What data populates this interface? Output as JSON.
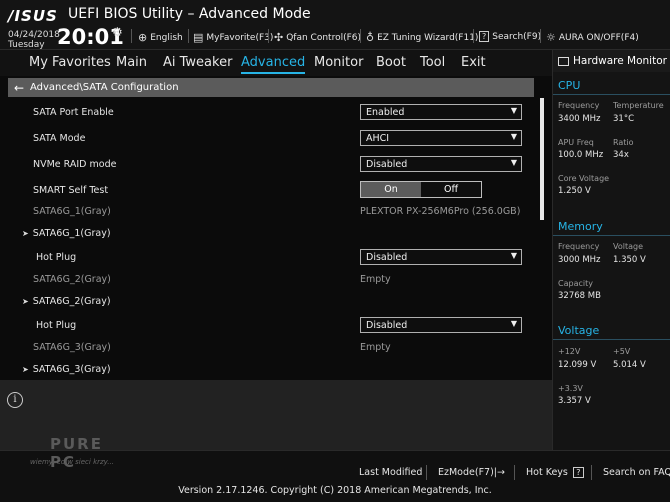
{
  "header": {
    "logo": "/ISUS",
    "title": "UEFI BIOS Utility – Advanced Mode",
    "date": "04/24/2018",
    "day": "Tuesday",
    "time": "20:01",
    "items": [
      {
        "icon": "globe-icon",
        "label": "English"
      },
      {
        "icon": "myfavorite-icon",
        "label": "MyFavorite(F3)"
      },
      {
        "icon": "fan-icon",
        "label": "Qfan Control(F6)"
      },
      {
        "icon": "lightbulb-icon",
        "label": "EZ Tuning Wizard(F11)"
      },
      {
        "icon": "search-icon",
        "label": "Search(F9)"
      },
      {
        "icon": "aura-icon",
        "label": "AURA ON/OFF(F4)"
      }
    ]
  },
  "menu": {
    "tabs": [
      {
        "label": "My Favorites"
      },
      {
        "label": "Main"
      },
      {
        "label": "Ai Tweaker"
      },
      {
        "label": "Advanced",
        "active": true
      },
      {
        "label": "Monitor"
      },
      {
        "label": "Boot"
      },
      {
        "label": "Tool"
      },
      {
        "label": "Exit"
      }
    ]
  },
  "breadcrumb": "Advanced\\SATA Configuration",
  "settings": {
    "sata_port_enable": {
      "label": "SATA Port Enable",
      "value": "Enabled"
    },
    "sata_mode": {
      "label": "SATA Mode",
      "value": "AHCI"
    },
    "nvme_raid": {
      "label": "NVMe RAID mode",
      "value": "Disabled"
    },
    "smart_self_test": {
      "label": "SMART Self Test",
      "on": "On",
      "off": "Off",
      "selected": "On"
    },
    "sata1_info": {
      "label": "SATA6G_1(Gray)",
      "value": "PLEXTOR PX-256M6Pro (256.0GB)"
    },
    "sata1_sub": {
      "label": "SATA6G_1(Gray)"
    },
    "sata1_hotplug": {
      "label": "Hot Plug",
      "value": "Disabled"
    },
    "sata2_info": {
      "label": "SATA6G_2(Gray)",
      "value": "Empty"
    },
    "sata2_sub": {
      "label": "SATA6G_2(Gray)"
    },
    "sata2_hotplug": {
      "label": "Hot Plug",
      "value": "Disabled"
    },
    "sata3_info": {
      "label": "SATA6G_3(Gray)",
      "value": "Empty"
    },
    "sata3_sub": {
      "label": "SATA6G_3(Gray)"
    }
  },
  "hw_monitor": {
    "title": "Hardware Monitor",
    "cpu": {
      "heading": "CPU",
      "frequency_label": "Frequency",
      "frequency": "3400 MHz",
      "temperature_label": "Temperature",
      "temperature": "31°C",
      "apu_freq_label": "APU Freq",
      "apu_freq": "100.0 MHz",
      "ratio_label": "Ratio",
      "ratio": "34x",
      "core_voltage_label": "Core Voltage",
      "core_voltage": "1.250 V"
    },
    "memory": {
      "heading": "Memory",
      "frequency_label": "Frequency",
      "frequency": "3000 MHz",
      "voltage_label": "Voltage",
      "voltage": "1.350 V",
      "capacity_label": "Capacity",
      "capacity": "32768 MB"
    },
    "voltage": {
      "heading": "Voltage",
      "v12_label": "+12V",
      "v12": "12.099 V",
      "v5_label": "+5V",
      "v5": "5.014 V",
      "v33_label": "+3.3V",
      "v33": "3.357 V"
    }
  },
  "footer": {
    "last_modified": "Last Modified",
    "ezmode": "EzMode(F7)|→",
    "hot_keys": "Hot Keys",
    "hot_keys_badge": "?",
    "search_faq": "Search on FAQ",
    "version": "Version 2.17.1246. Copyright (C) 2018 American Megatrends, Inc."
  },
  "watermark": {
    "logo": "PURE PC",
    "tagline": "wiemy, co w sieci krzy..."
  }
}
